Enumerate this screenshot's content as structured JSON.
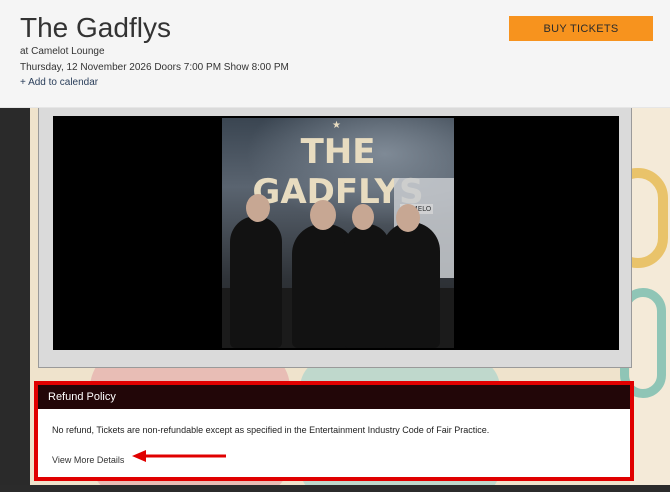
{
  "header": {
    "title": "The Gadflys",
    "venue": "at Camelot Lounge",
    "datetime": "Thursday, 12 November 2026 Doors 7:00 PM Show 8:00 PM",
    "add_to_calendar": "+ Add to calendar",
    "buy_button": "BUY TICKETS"
  },
  "poster": {
    "band_name": "THE GADFLYS",
    "sign_text": "CAMELO"
  },
  "refund": {
    "heading": "Refund Policy",
    "text": "No refund, Tickets are non-refundable except as specified in the Entertainment Industry Code of Fair Practice.",
    "link": "View More Details"
  },
  "colors": {
    "accent": "#f7931e",
    "refund_header": "#220608",
    "highlight": "#e00000"
  }
}
